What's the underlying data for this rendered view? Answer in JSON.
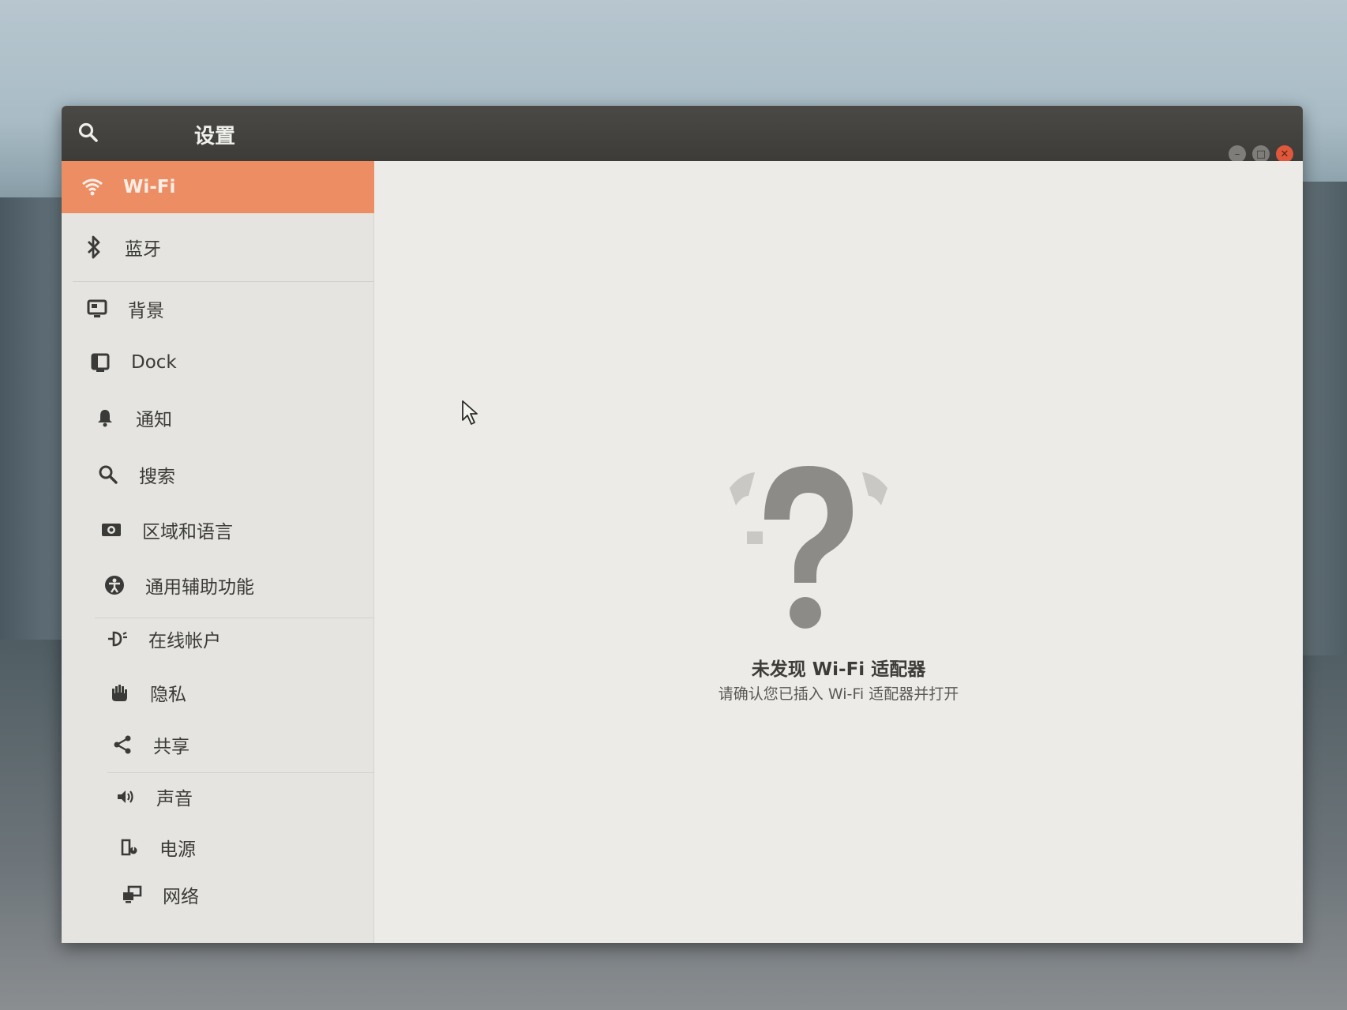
{
  "window": {
    "title": "设置",
    "controls": {
      "minimize_icon": "minimize-icon",
      "maximize_icon": "maximize-icon",
      "close_icon": "close-icon",
      "close_color": "#e0583b"
    }
  },
  "accent_color": "#ec8d63",
  "sidebar": {
    "items": [
      {
        "label": "Wi-Fi",
        "icon": "wifi-icon",
        "active": true
      },
      {
        "label": "蓝牙",
        "icon": "bluetooth-icon",
        "active": false
      },
      {
        "label": "背景",
        "icon": "background-icon",
        "active": false
      },
      {
        "label": "Dock",
        "icon": "dock-icon",
        "active": false
      },
      {
        "label": "通知",
        "icon": "bell-icon",
        "active": false
      },
      {
        "label": "搜索",
        "icon": "search-icon",
        "active": false
      },
      {
        "label": "区域和语言",
        "icon": "region-icon",
        "active": false
      },
      {
        "label": "通用辅助功能",
        "icon": "accessibility-icon",
        "active": false
      },
      {
        "label": "在线帐户",
        "icon": "online-accounts-icon",
        "active": false
      },
      {
        "label": "隐私",
        "icon": "privacy-hand-icon",
        "active": false
      },
      {
        "label": "共享",
        "icon": "share-icon",
        "active": false
      },
      {
        "label": "声音",
        "icon": "speaker-icon",
        "active": false
      },
      {
        "label": "电源",
        "icon": "power-icon",
        "active": false
      },
      {
        "label": "网络",
        "icon": "network-icon",
        "active": false
      }
    ]
  },
  "main": {
    "empty_state": {
      "icon": "question-mark-icon",
      "title": "未发现 Wi-Fi 适配器",
      "subtitle": "请确认您已插入 Wi-Fi 适配器并打开"
    }
  }
}
